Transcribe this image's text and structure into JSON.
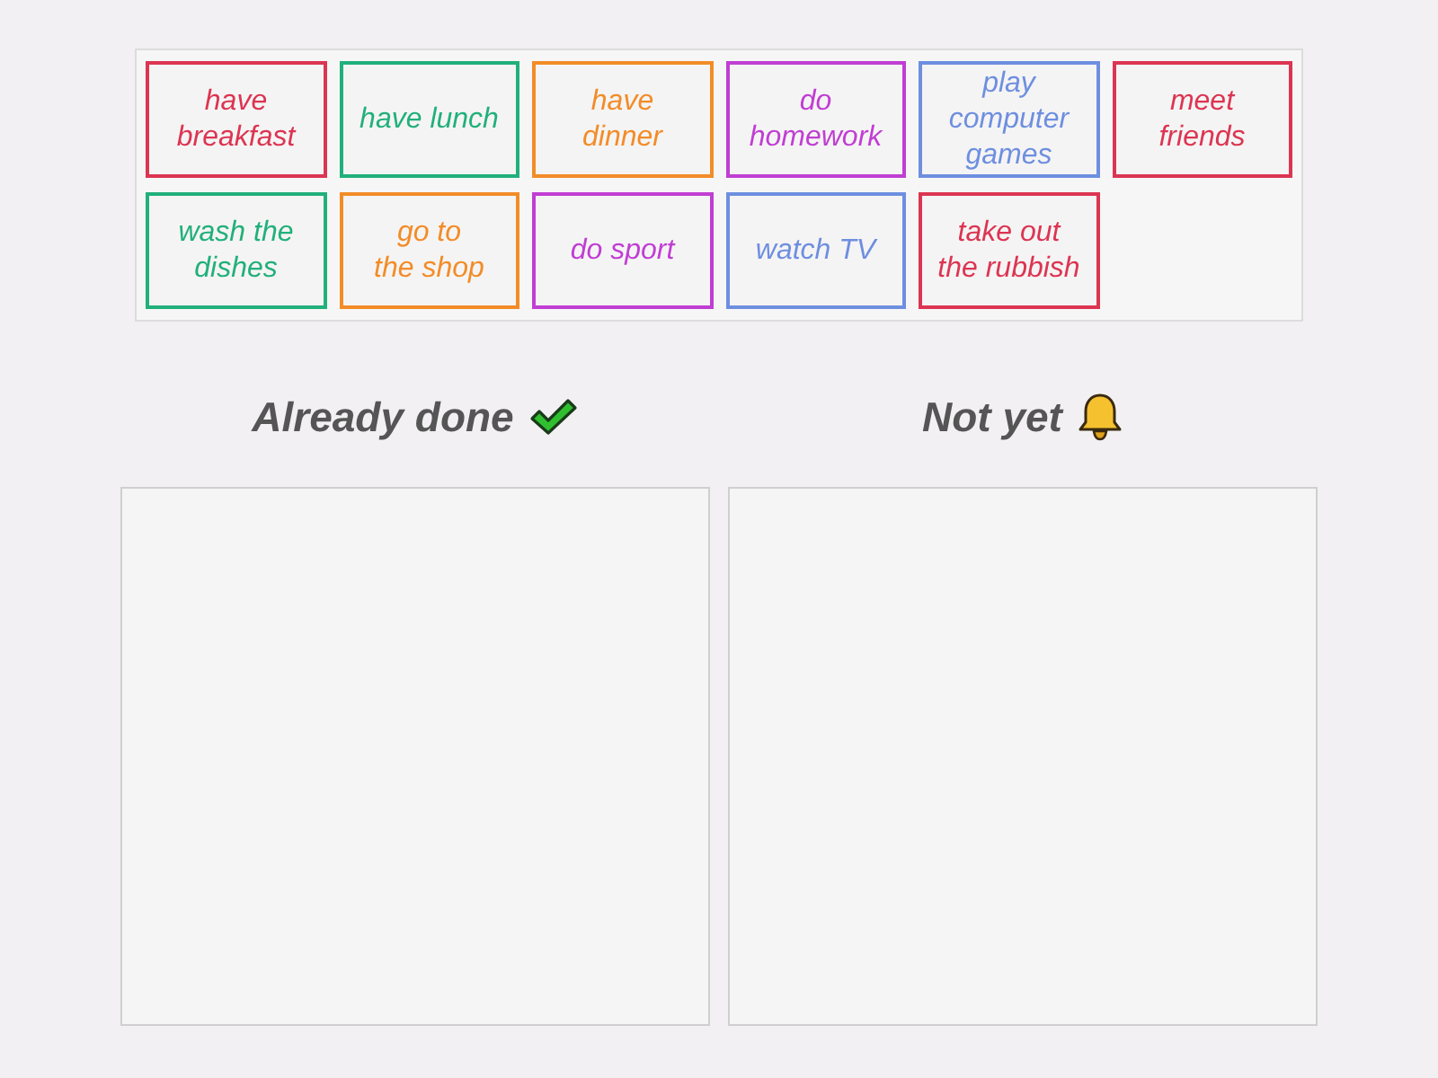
{
  "tiles": [
    {
      "text": "have\nbreakfast",
      "color": "#dc3552"
    },
    {
      "text": "have lunch",
      "color": "#21b07b"
    },
    {
      "text": "have\ndinner",
      "color": "#f28c28"
    },
    {
      "text": "do\nhomework",
      "color": "#c03ed3"
    },
    {
      "text": "play\ncomputer\ngames",
      "color": "#6e8fe0"
    },
    {
      "text": "meet\nfriends",
      "color": "#dc3552"
    },
    {
      "text": "wash the\ndishes",
      "color": "#21b07b"
    },
    {
      "text": "go to\nthe shop",
      "color": "#f28c28"
    },
    {
      "text": "do sport",
      "color": "#c03ed3"
    },
    {
      "text": "watch TV",
      "color": "#6e8fe0"
    },
    {
      "text": "take out\nthe rubbish",
      "color": "#dc3552"
    }
  ],
  "columns": [
    {
      "kind": "done",
      "heading": "Already done"
    },
    {
      "kind": "pending",
      "heading": "Not yet"
    }
  ]
}
